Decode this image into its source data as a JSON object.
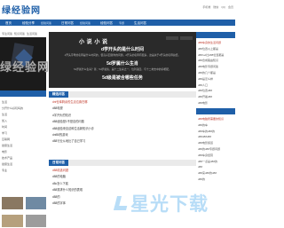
{
  "header": {
    "logo": "绿经验网",
    "toplinks": [
      "手机端",
      "微信",
      "QQ",
      "会员"
    ]
  },
  "nav": {
    "items": [
      "首页",
      "经验分享",
      "日常问答",
      "经验问答",
      "生活问答",
      "情感问答",
      "产品问答",
      "生活问答"
    ],
    "light": [
      "经验问答",
      "经验问答",
      "专题"
    ]
  },
  "left": {
    "tabs": [
      "专注问答",
      "知识问答",
      "生活问答"
    ],
    "card_watermark": "绿经验网",
    "list": [
      "生活",
      "分开什么好玩吗的",
      "生活",
      "加入",
      "时间",
      "学习",
      "互联网",
      "健康生活",
      "电影",
      "技术产品",
      "健康生活",
      "专业"
    ],
    "label_bottom": "分类"
  },
  "center": {
    "hero": {
      "title": "小 说 小 说",
      "headline1": "d学开头的是什么时间",
      "para1": "d开头字母的名称是什么时间的，很高兴回答你的问题，d开头的名称有很多，这是关于d开头的名称总结。",
      "headline2": "5d罗属什么生肖",
      "para2": "5d罗属什么生肖？答：5d罗属兔，是十二生肖之一，位列第四，与十二地支中的卯相配。",
      "headline3": "5d级是被合哪些任务"
    },
    "section1": {
      "title": "精选问答",
      "items": [
        "dnf仓库剩余的生活位置在哪",
        "d88电视",
        "d字开头的知识",
        "d88经验是1不是自的问题",
        "d88经验来自这种生活新知识小诊",
        "dnf88的游戏",
        "d88行业从地比了自己学习"
      ]
    },
    "section2": {
      "title": "日常问答",
      "items": [
        "d88精选问题",
        "d88的电脑",
        "d8c怎么下载",
        "d88需求什么知识的表现",
        "d88的",
        "d88的字体"
      ]
    }
  },
  "right": {
    "bar1": "热门问答",
    "list1": [
      "d88车身的生活问题",
      "d88位置以上都是",
      "d88rod比d88位置都是",
      "d88合成路由知识",
      "d88电影专题问答",
      "d88的几个都是",
      "d88是怎么样",
      "d88人口",
      "d88位置d88",
      "d88开着d88",
      "d88电影"
    ],
    "bar2": "最新文章",
    "list2": [
      "d88电脑所需要的知识",
      "d88的车",
      "d88车的d88的",
      "d88d88d88",
      "d88电影频道",
      "d88的d88专题问题",
      "d88车身经营",
      "d88一点是d88的",
      "d88",
      "d88来d88的d88",
      "d88的"
    ]
  },
  "watermark": "星光下载"
}
